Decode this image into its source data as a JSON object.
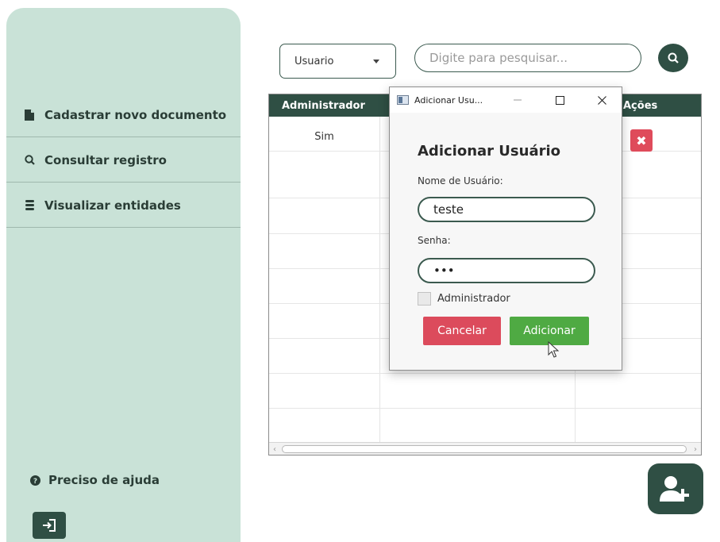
{
  "sidebar": {
    "items": [
      {
        "label": "Cadastrar novo documento",
        "icon": "file-icon"
      },
      {
        "label": "Consultar registro",
        "icon": "search-icon"
      },
      {
        "label": "Visualizar entidades",
        "icon": "database-icon"
      }
    ],
    "help_label": "Preciso de ajuda",
    "logout_icon": "logout-icon"
  },
  "filter": {
    "selected": "Usuario",
    "search_placeholder": "Digite para pesquisar..."
  },
  "table": {
    "columns": [
      "Administrador",
      "Ações"
    ],
    "rows": [
      {
        "administrador": "Sim",
        "delete_label": "✖"
      }
    ]
  },
  "dialog": {
    "window_title": "Adicionar Usu...",
    "title": "Adicionar Usuário",
    "username_label": "Nome de Usuário:",
    "username_value": "teste",
    "password_label": "Senha:",
    "password_value": "abc",
    "admin_label": "Administrador",
    "cancel_label": "Cancelar",
    "add_label": "Adicionar"
  },
  "colors": {
    "sidebar_bg": "#c9e2d7",
    "primary": "#2f4f44",
    "danger": "#dc4b5c",
    "success": "#4faa43"
  }
}
